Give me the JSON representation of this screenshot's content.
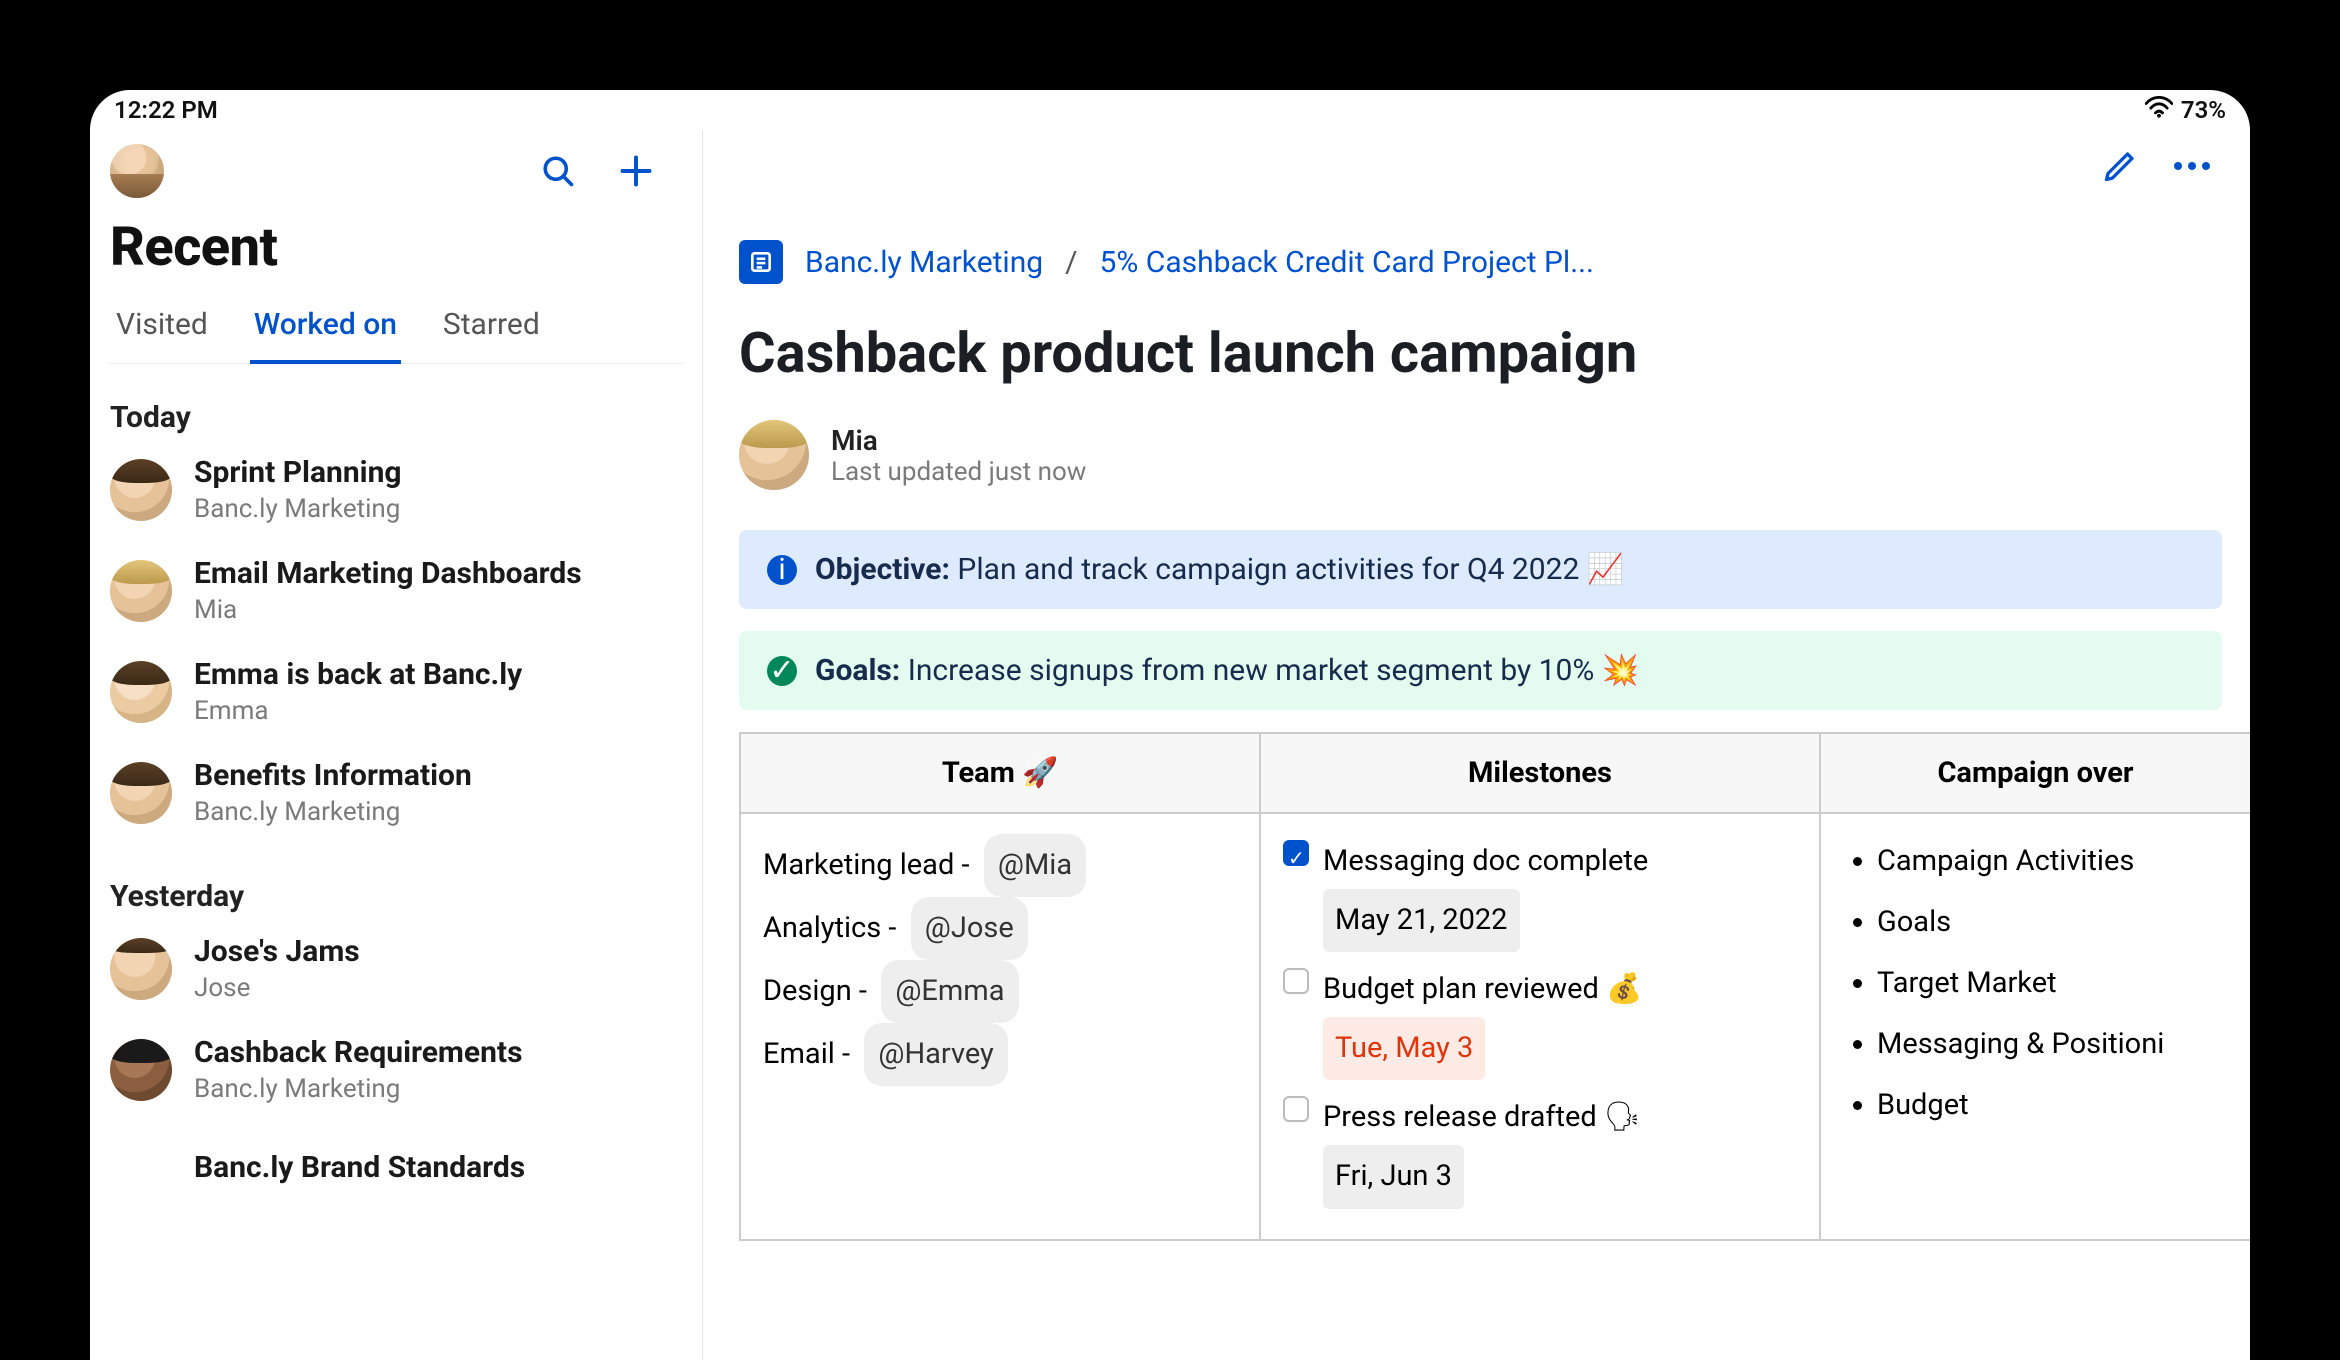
{
  "status_bar": {
    "time": "12:22 PM",
    "battery": "73%"
  },
  "sidebar": {
    "title": "Recent",
    "tabs": [
      {
        "label": "Visited",
        "active": false
      },
      {
        "label": "Worked on",
        "active": true
      },
      {
        "label": "Starred",
        "active": false
      }
    ],
    "groups": [
      {
        "label": "Today",
        "items": [
          {
            "title": "Sprint Planning",
            "sub": "Banc.ly Marketing"
          },
          {
            "title": "Email Marketing Dashboards",
            "sub": "Mia"
          },
          {
            "title": "Emma is back at Banc.ly",
            "sub": "Emma"
          },
          {
            "title": "Benefits Information",
            "sub": "Banc.ly Marketing"
          }
        ]
      },
      {
        "label": "Yesterday",
        "items": [
          {
            "title": "Jose's Jams",
            "sub": "Jose"
          },
          {
            "title": "Cashback Requirements",
            "sub": "Banc.ly Marketing"
          },
          {
            "title": "Banc.ly Brand Standards",
            "sub": ""
          }
        ]
      }
    ]
  },
  "breadcrumb": {
    "space": "Banc.ly Marketing",
    "parent": "5% Cashback Credit Card Project Pl..."
  },
  "page": {
    "title": "Cashback product launch campaign",
    "author": "Mia",
    "updated": "Last updated just now"
  },
  "panels": {
    "objective_label": "Objective:",
    "objective_text": "Plan and track campaign activities for Q4 2022 📈",
    "goals_label": "Goals:",
    "goals_text": "Increase signups from new market segment by 10% 💥"
  },
  "table": {
    "headers": {
      "team": "Team 🚀",
      "milestones": "Milestones",
      "overview": "Campaign over"
    },
    "team": [
      {
        "role": "Marketing lead",
        "mention": "@Mia"
      },
      {
        "role": "Analytics",
        "mention": "@Jose"
      },
      {
        "role": "Design",
        "mention": "@Emma"
      },
      {
        "role": "Email",
        "mention": "@Harvey"
      }
    ],
    "milestones": [
      {
        "done": true,
        "text": "Messaging doc complete",
        "date": "May 21, 2022",
        "date_style": ""
      },
      {
        "done": false,
        "text": "Budget plan reviewed 💰",
        "date": "Tue, May 3",
        "date_style": "red"
      },
      {
        "done": false,
        "text": "Press release drafted 🗣",
        "date": "Fri, Jun 3",
        "date_style": ""
      }
    ],
    "overview": [
      "Campaign Activities",
      "Goals",
      "Target Market",
      "Messaging & Positioni",
      "Budget"
    ]
  }
}
